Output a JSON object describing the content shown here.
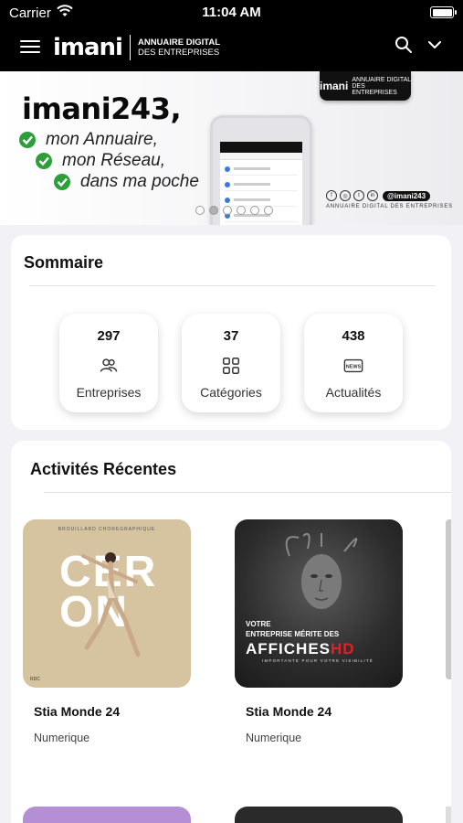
{
  "status_bar": {
    "carrier": "Carrier",
    "time": "11:04 AM"
  },
  "nav": {
    "logo_word": "imani",
    "logo_sub_line1": "ANNUAIRE DIGITAL",
    "logo_sub_line2": "DES ENTREPRISES",
    "icons": [
      "menu-icon",
      "search-icon",
      "chevron-down-icon"
    ]
  },
  "banner": {
    "brand": "imani243,",
    "taglines": [
      "mon Annuaire,",
      "mon Réseau,",
      "dans ma poche"
    ],
    "badge_word": "imani",
    "badge_sub": "ANNUAIRE DIGITAL DES ENTREPRISES",
    "handle": "@imani243",
    "footer": "ANNUAIRE DIGITAL DES ENTREPRISES",
    "active_slide": 2,
    "slide_count": 6
  },
  "sommaire": {
    "title": "Sommaire",
    "stats": [
      {
        "value": "297",
        "label": "Entreprises",
        "icon": "users-icon"
      },
      {
        "value": "37",
        "label": "Catégories",
        "icon": "grid-icon"
      },
      {
        "value": "438",
        "label": "Actualités",
        "icon": "news-icon"
      }
    ]
  },
  "activites": {
    "title": "Activités Récentes",
    "posts": [
      {
        "title": "Stia Monde 24",
        "subtitle": "Numerique",
        "poster_top": "BROUILLARD CHOREGRAPHIQUE",
        "poster_text": "CER ON",
        "poster_bottom": "RDC"
      },
      {
        "title": "Stia Monde 24",
        "subtitle": "Numerique",
        "poster_l1": "VOTRE",
        "poster_l2": "ENTREPRISE MÉRITE DES",
        "poster_l3a": "AFFICHES",
        "poster_l3b": "HD",
        "poster_l4": "IMPORTANTE POUR VOTRE VISIBILITÉ"
      }
    ]
  },
  "colors": {
    "accent_green": "#2e9e3a",
    "nav_bg": "#000000",
    "poster_red": "#e0202a"
  }
}
